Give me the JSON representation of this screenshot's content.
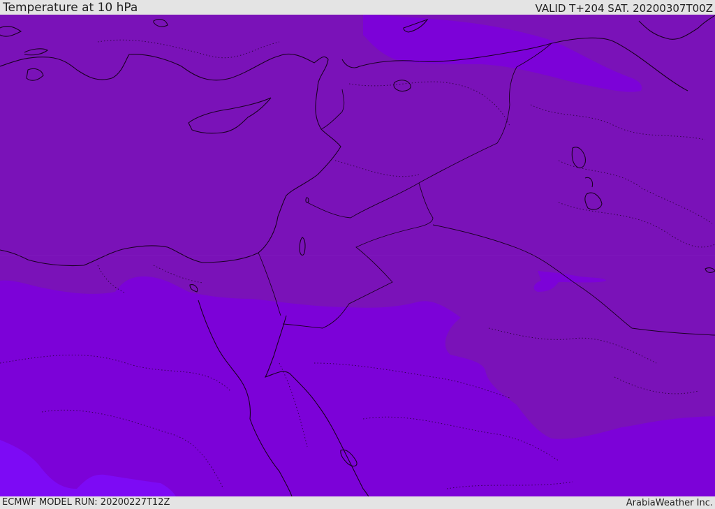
{
  "header": {
    "title": "Temperature at 10 hPa",
    "valid": "VALID T+204 SAT. 20200307T00Z"
  },
  "footer": {
    "model_run": "ECMWF MODEL RUN: 20200227T12Z",
    "credit": "ArabiaWeather Inc."
  },
  "colors": {
    "warmer_band": "#7a12b8",
    "cooler_band": "#7c02d8",
    "coldest_band": "#7d0af5",
    "borders": "#1a0022",
    "frame": "#e4e4e4"
  }
}
